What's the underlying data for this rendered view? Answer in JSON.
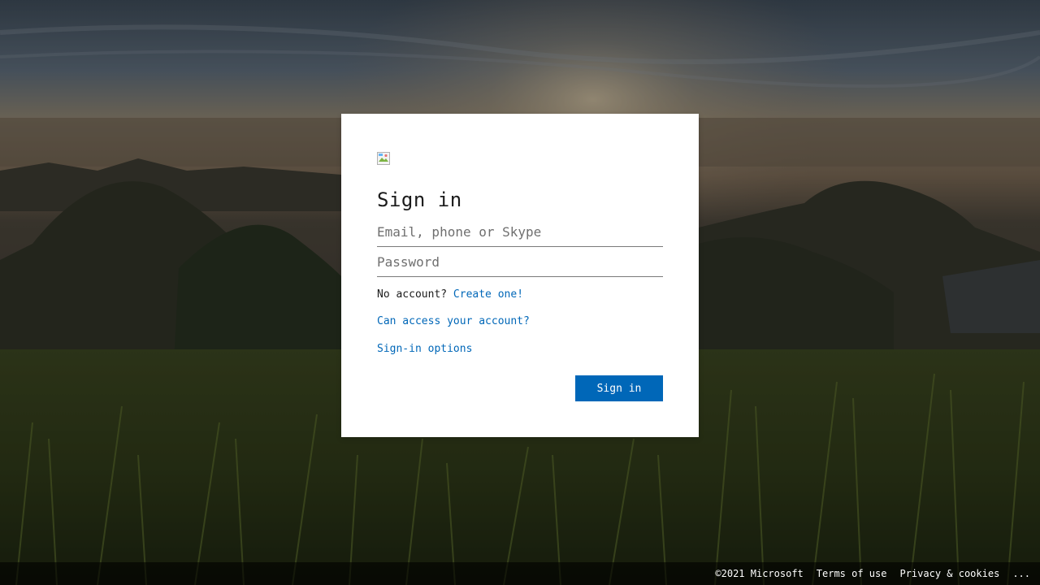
{
  "signin": {
    "title": "Sign in",
    "email_placeholder": "Email, phone or Skype",
    "password_placeholder": "Password",
    "no_account_text": "No account?",
    "create_link": "Create one!",
    "access_link": "Can access your account?",
    "options_link": "Sign-in options",
    "submit_label": "Sign in"
  },
  "footer": {
    "copyright": "©2021 Microsoft",
    "terms": "Terms of use",
    "privacy": "Privacy & cookies",
    "more": "..."
  },
  "colors": {
    "accent": "#0067b8",
    "card_bg": "#ffffff",
    "text": "#1b1b1b"
  },
  "icons": {
    "logo": "broken-image-icon"
  }
}
